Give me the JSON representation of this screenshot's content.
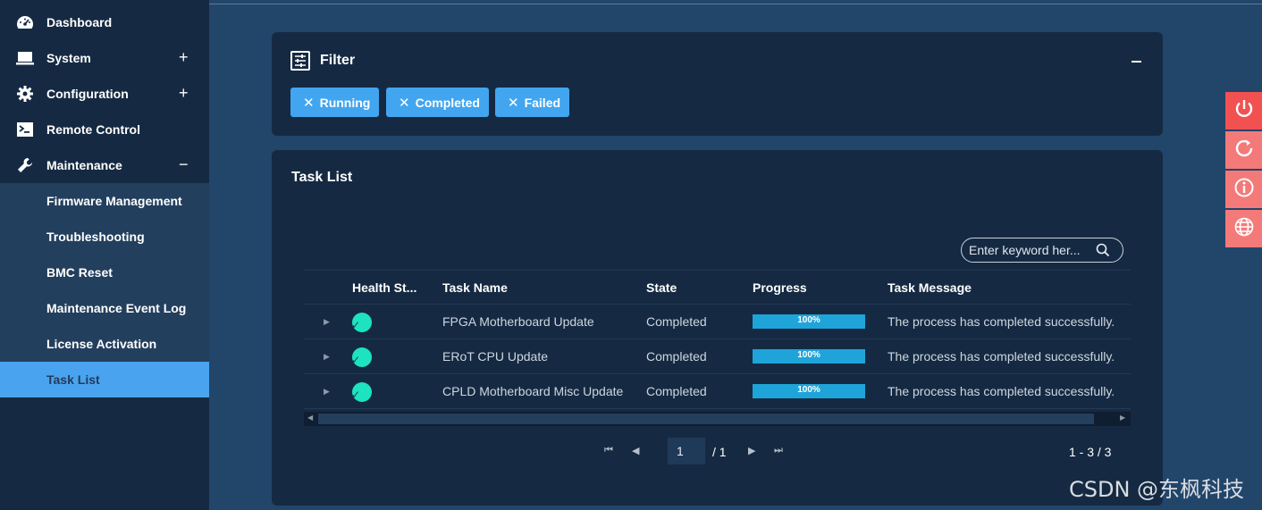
{
  "sidebar": {
    "items": [
      {
        "label": "Dashboard",
        "icon": "dashboard-icon"
      },
      {
        "label": "System",
        "icon": "monitor-icon",
        "toggle": "+"
      },
      {
        "label": "Configuration",
        "icon": "gear-icon",
        "toggle": "+"
      },
      {
        "label": "Remote Control",
        "icon": "terminal-icon"
      },
      {
        "label": "Maintenance",
        "icon": "wrench-icon",
        "toggle": "−"
      }
    ],
    "sub_items": [
      "Firmware Management",
      "Troubleshooting",
      "BMC Reset",
      "Maintenance Event Log",
      "License Activation",
      "Task List"
    ],
    "active": "Task List"
  },
  "filter": {
    "title": "Filter",
    "chips": [
      "Running",
      "Completed",
      "Failed"
    ]
  },
  "task_list": {
    "title": "Task List",
    "search_placeholder": "Enter keyword her...",
    "columns": [
      "Health St...",
      "Task Name",
      "State",
      "Progress",
      "Task Message"
    ],
    "rows": [
      {
        "task_name": "FPGA Motherboard Update",
        "state": "Completed",
        "progress_label": "100%",
        "progress": 100,
        "message": "The process has completed successfully."
      },
      {
        "task_name": "ERoT CPU Update",
        "state": "Completed",
        "progress_label": "100%",
        "progress": 100,
        "message": "The process has completed successfully."
      },
      {
        "task_name": "CPLD Motherboard Misc Update",
        "state": "Completed",
        "progress_label": "100%",
        "progress": 100,
        "message": "The process has completed successfully."
      }
    ],
    "pagination": {
      "page": "1",
      "total": "/ 1",
      "range": "1 - 3 / 3"
    }
  },
  "side_actions": [
    {
      "name": "power-icon",
      "color": "#f25151"
    },
    {
      "name": "refresh-icon",
      "color": "#f47a7a"
    },
    {
      "name": "info-icon",
      "color": "#f47a7a"
    },
    {
      "name": "globe-icon",
      "color": "#f47a7a"
    }
  ],
  "watermark": "CSDN @东枫科技",
  "colors": {
    "accent": "#42a5ef",
    "health_ok": "#1de3c0",
    "progress": "#1fa4d9",
    "background": "#22456a",
    "panel": "#152a42"
  }
}
